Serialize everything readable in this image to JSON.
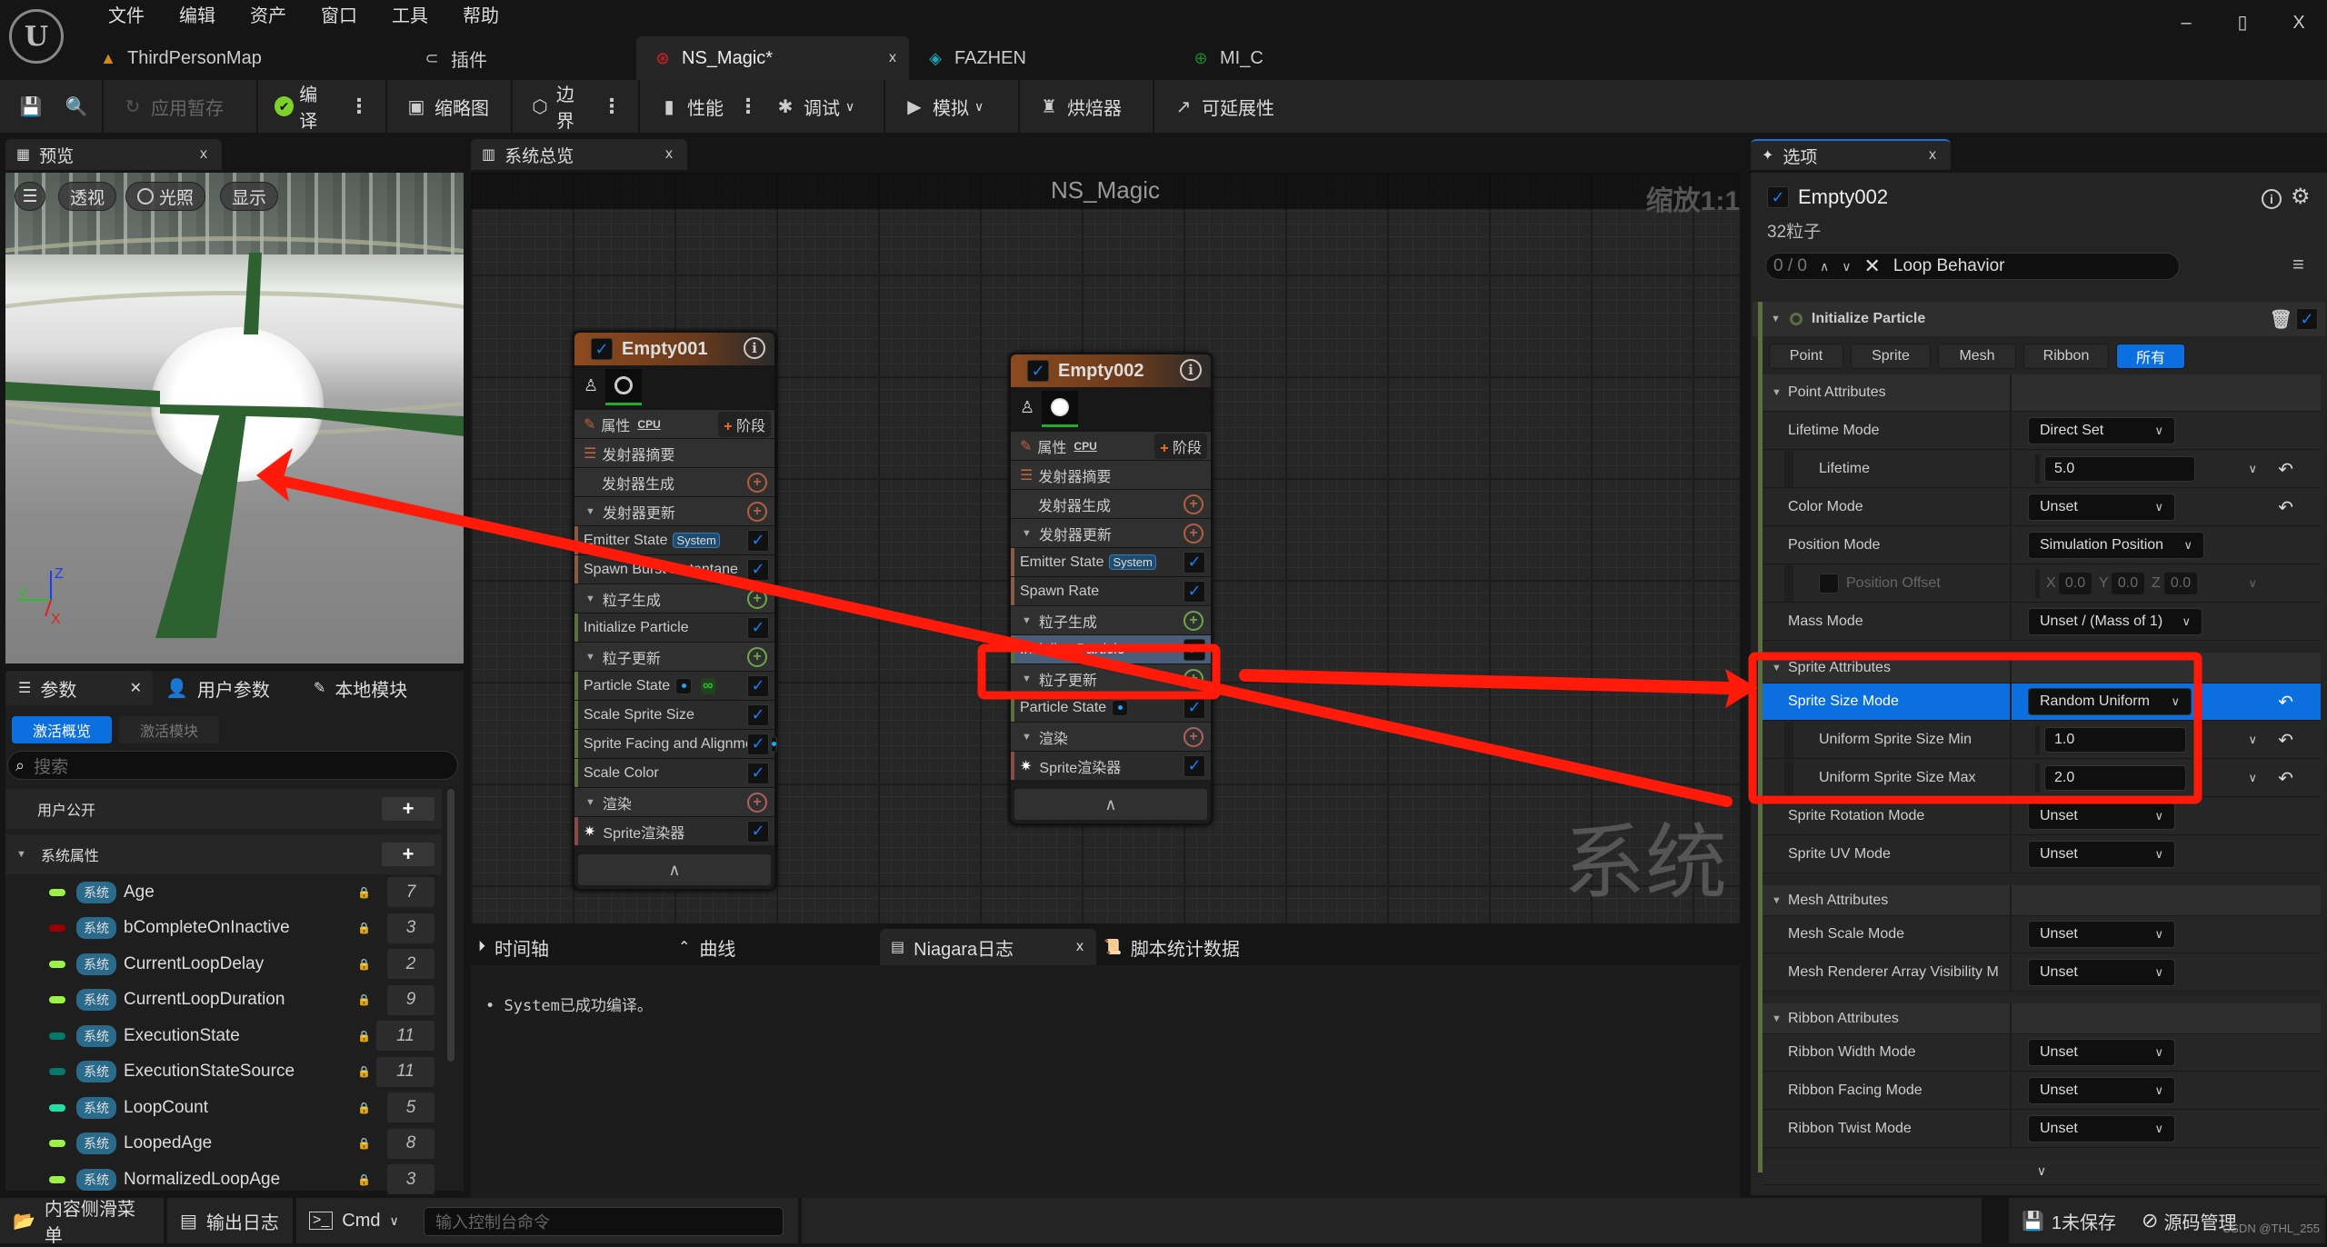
{
  "menu": [
    "文件",
    "编辑",
    "资产",
    "窗口",
    "工具",
    "帮助"
  ],
  "window_controls": {
    "minimize": "–",
    "restore": "▯",
    "close": "X"
  },
  "doc_tabs": [
    {
      "label": "ThirdPersonMap",
      "icon": "level-icon",
      "active": false
    },
    {
      "label": "插件",
      "icon": "plugin-icon",
      "active": false
    },
    {
      "label": "NS_Magic*",
      "icon": "niagara-system-icon",
      "active": true
    },
    {
      "label": "FAZHEN",
      "icon": "niagara-emitter-icon",
      "active": false
    },
    {
      "label": "MI_C",
      "icon": "material-instance-icon",
      "active": false
    }
  ],
  "toolbar": {
    "apply_label": "应用暂存",
    "compile_label": "编译",
    "thumbnail_label": "缩略图",
    "bounds_label": "边界",
    "performance_label": "性能",
    "debug_label": "调试",
    "simulate_label": "模拟",
    "baker_label": "烘焙器",
    "scalability_label": "可延展性"
  },
  "preview_panel": {
    "tab_label": "预览",
    "view_menu": "☰",
    "perspective_label": "透视",
    "lighting_label": "光照",
    "show_label": "显示",
    "axis": {
      "x": "X",
      "y": "Y",
      "z": "Z"
    }
  },
  "params_panel": {
    "tabs": [
      {
        "label": "参数",
        "active": true
      },
      {
        "label": "用户参数",
        "active": false
      },
      {
        "label": "本地模块",
        "active": false
      }
    ],
    "subtabs": [
      {
        "label": "激活概览",
        "active": true
      },
      {
        "label": "激活模块",
        "active": false
      }
    ],
    "search_placeholder": "搜索",
    "user_exposed_label": "用户公开",
    "system_attributes_label": "系统属性",
    "add_label": "+",
    "system_badge": "系统",
    "params": [
      {
        "name": "Age",
        "color": "#9ef04a",
        "count": "7"
      },
      {
        "name": "bCompleteOnInactive",
        "color": "#990000",
        "count": "3"
      },
      {
        "name": "CurrentLoopDelay",
        "color": "#9ef04a",
        "count": "2"
      },
      {
        "name": "CurrentLoopDuration",
        "color": "#9ef04a",
        "count": "9"
      },
      {
        "name": "ExecutionState",
        "color": "#007a6a",
        "count": "11"
      },
      {
        "name": "ExecutionStateSource",
        "color": "#007a6a",
        "count": "11"
      },
      {
        "name": "LoopCount",
        "color": "#20e0a8",
        "count": "5"
      },
      {
        "name": "LoopedAge",
        "color": "#9ef04a",
        "count": "8"
      },
      {
        "name": "NormalizedLoopAge",
        "color": "#9ef04a",
        "count": "3"
      }
    ]
  },
  "graph": {
    "tab_label": "系统总览",
    "title": "NS_Magic",
    "zoom_label": "缩放1:1",
    "watermark": "系统",
    "nodes": [
      {
        "name": "Empty001",
        "properties_label": "属性",
        "sim_target": "CPU",
        "stage_label": "阶段",
        "summary_label": "发射器摘要",
        "emitter_spawn_label": "发射器生成",
        "emitter_update_label": "发射器更新",
        "emitter_update_modules": [
          {
            "label": "Emitter State",
            "tag": "System"
          },
          {
            "label": "Spawn Burst Instantaneous",
            "tag": ""
          }
        ],
        "particle_spawn_label": "粒子生成",
        "particle_spawn_modules": [
          {
            "label": "Initialize Particle"
          }
        ],
        "particle_update_label": "粒子更新",
        "particle_update_modules": [
          {
            "label": "Particle State"
          },
          {
            "label": "Scale Sprite Size"
          },
          {
            "label": "Sprite Facing and Alignment"
          },
          {
            "label": "Scale Color"
          }
        ],
        "render_label": "渲染",
        "renderers": [
          {
            "label": "Sprite渲染器"
          }
        ]
      },
      {
        "name": "Empty002",
        "properties_label": "属性",
        "sim_target": "CPU",
        "stage_label": "阶段",
        "summary_label": "发射器摘要",
        "emitter_spawn_label": "发射器生成",
        "emitter_update_label": "发射器更新",
        "emitter_update_modules": [
          {
            "label": "Emitter State",
            "tag": "System"
          },
          {
            "label": "Spawn Rate",
            "tag": ""
          }
        ],
        "particle_spawn_label": "粒子生成",
        "particle_spawn_modules": [
          {
            "label": "Initialize Particle",
            "selected": true
          }
        ],
        "particle_update_label": "粒子更新",
        "particle_update_modules": [
          {
            "label": "Particle State"
          }
        ],
        "render_label": "渲染",
        "renderers": [
          {
            "label": "Sprite渲染器"
          }
        ]
      }
    ]
  },
  "bottom_tabs": [
    {
      "label": "时间轴",
      "active": false
    },
    {
      "label": "曲线",
      "active": false
    },
    {
      "label": "Niagara日志",
      "active": true
    },
    {
      "label": "脚本统计数据",
      "active": false
    }
  ],
  "log": {
    "messages": [
      "System已成功编译。"
    ]
  },
  "details": {
    "tab_label": "选项",
    "emitter_name": "Empty002",
    "particle_count": "32粒子",
    "search": {
      "counter": "0 / 0",
      "value": "Loop Behavior"
    },
    "module_title": "Initialize Particle",
    "filters": [
      {
        "label": "Point",
        "active": false
      },
      {
        "label": "Sprite",
        "active": false
      },
      {
        "label": "Mesh",
        "active": false
      },
      {
        "label": "Ribbon",
        "active": false
      },
      {
        "label": "所有",
        "active": true
      }
    ],
    "point_attributes": {
      "label": "Point Attributes",
      "lifetime_mode": {
        "label": "Lifetime Mode",
        "value": "Direct Set"
      },
      "lifetime": {
        "label": "Lifetime",
        "value": "5.0"
      },
      "color_mode": {
        "label": "Color Mode",
        "value": "Unset"
      },
      "position_mode": {
        "label": "Position Mode",
        "value": "Simulation Position"
      },
      "position_offset": {
        "label": "Position Offset",
        "x": "0.0",
        "y": "0.0",
        "z": "0.0"
      },
      "mass_mode": {
        "label": "Mass Mode",
        "value": "Unset / (Mass of 1)"
      }
    },
    "sprite_attributes": {
      "label": "Sprite Attributes",
      "size_mode": {
        "label": "Sprite Size Mode",
        "value": "Random Uniform"
      },
      "size_min": {
        "label": "Uniform Sprite Size Min",
        "value": "1.0"
      },
      "size_max": {
        "label": "Uniform Sprite Size Max",
        "value": "2.0"
      },
      "rotation_mode": {
        "label": "Sprite Rotation Mode",
        "value": "Unset"
      },
      "uv_mode": {
        "label": "Sprite UV Mode",
        "value": "Unset"
      }
    },
    "mesh_attributes": {
      "label": "Mesh Attributes",
      "scale_mode": {
        "label": "Mesh Scale Mode",
        "value": "Unset"
      },
      "visibility_mode": {
        "label": "Mesh Renderer Array Visibility M",
        "value": "Unset"
      }
    },
    "ribbon_attributes": {
      "label": "Ribbon Attributes",
      "width_mode": {
        "label": "Ribbon Width Mode",
        "value": "Unset"
      },
      "facing_mode": {
        "label": "Ribbon Facing Mode",
        "value": "Unset"
      },
      "twist_mode": {
        "label": "Ribbon Twist Mode",
        "value": "Unset"
      }
    }
  },
  "statusbar": {
    "content_drawer": "内容侧滑菜单",
    "output_log": "输出日志",
    "cmd_label": "Cmd",
    "cmd_placeholder": "输入控制台命令",
    "unsaved": "1未保存",
    "source_control": "源码管理",
    "watermark": "CSDN @THL_255"
  },
  "colors": {
    "accent": "#0b6fe0",
    "annotation": "#ff1a0a",
    "emitter_header": "#8c4a1e",
    "module_green": "#5a7040"
  }
}
